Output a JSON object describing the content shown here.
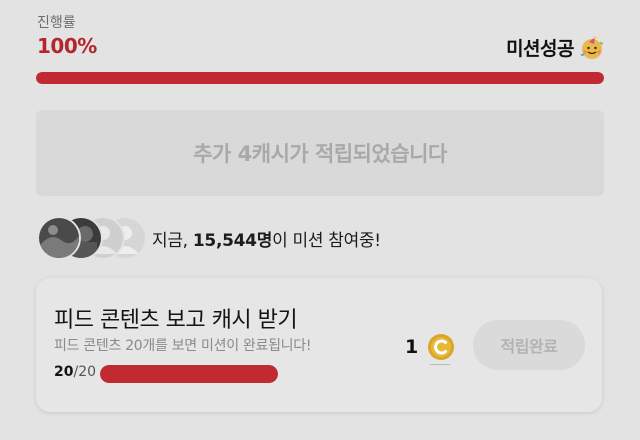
{
  "header": {
    "progress_label": "진행률",
    "progress_value": "100%",
    "progress_fraction": 1.0,
    "mission_status": "미션성공",
    "status_icon": "party-face-icon"
  },
  "reward_banner": {
    "text": "추가 4캐시가 적립되었습니다"
  },
  "participants": {
    "prefix": "지금,",
    "count": "15,544명",
    "suffix": "이 미션 참여중!",
    "avatars": [
      "avatar-photo-1",
      "avatar-photo-2",
      "avatar-placeholder-1",
      "avatar-placeholder-2"
    ]
  },
  "mission_card": {
    "title": "피드 콘텐츠 보고 캐시 받기",
    "description": "피드 콘텐츠 20개를 보면 미션이 완료됩니다!",
    "count_done": "20",
    "count_total": "/20",
    "progress_fraction": 1.0,
    "cash_amount": "1",
    "coin_icon": "cash-coin-icon",
    "button_label": "적립완료"
  },
  "colors": {
    "accent": "#c22a31",
    "background": "#e3e3e3",
    "muted_text": "#a9a9a9"
  }
}
